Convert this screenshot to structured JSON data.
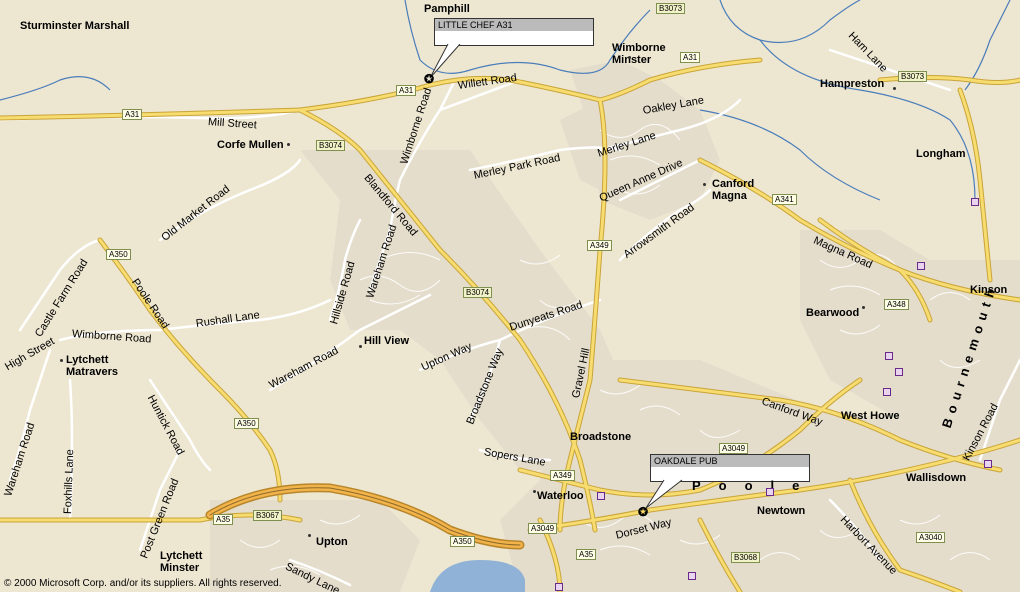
{
  "places": [
    {
      "id": "sturminster-marshall",
      "text": "Sturminster Marshall"
    },
    {
      "id": "pamphill",
      "text": "Pamphill"
    },
    {
      "id": "wimborne-minster",
      "text": "Wimborne\nMinster"
    },
    {
      "id": "hampreston",
      "text": "Hampreston"
    },
    {
      "id": "corfe-mullen",
      "text": "Corfe Mullen"
    },
    {
      "id": "longham",
      "text": "Longham"
    },
    {
      "id": "canford-magna",
      "text": "Canford\nMagna"
    },
    {
      "id": "kinson",
      "text": "Kinson"
    },
    {
      "id": "bearwood",
      "text": "Bearwood"
    },
    {
      "id": "hill-view",
      "text": "Hill View"
    },
    {
      "id": "lytchett-matravers",
      "text": "Lytchett\nMatravers"
    },
    {
      "id": "west-howe",
      "text": "West Howe"
    },
    {
      "id": "broadstone",
      "text": "Broadstone"
    },
    {
      "id": "wallisdown",
      "text": "Wallisdown"
    },
    {
      "id": "waterloo",
      "text": "Waterloo"
    },
    {
      "id": "newtown",
      "text": "Newtown"
    },
    {
      "id": "upton",
      "text": "Upton"
    },
    {
      "id": "lytchett-minster",
      "text": "Lytchett\nMinster"
    }
  ],
  "roads": [
    "Mill Street",
    "Willett Road",
    "Wimborne Road",
    "Blandford Road",
    "Merley Park Road",
    "Oakley Lane",
    "Merley Lane",
    "Queen Anne Drive",
    "Arrowsmith Road",
    "Old Market Road",
    "Castle Farm Road",
    "Poole Road",
    "Wimborne Road",
    "Rushall Lane",
    "Hillside Road",
    "Wareham Road",
    "Wareham Road",
    "Upton Way",
    "Dunyeats Road",
    "Broadstone Way",
    "Gravel Hill",
    "High Street",
    "Huntick Road",
    "Wareham Road",
    "Foxhills Lane",
    "Post Green Road",
    "Sopers Lane",
    "Canford Way",
    "Magna Road",
    "Ham Lane",
    "Kinson Road",
    "Harbort Avenue",
    "Dorset Way",
    "Sandy Lane"
  ],
  "shields": [
    "B3073",
    "A31",
    "A31",
    "A31",
    "B3073",
    "B3074",
    "A341",
    "A349",
    "B3074",
    "A350",
    "A348",
    "A350",
    "A3049",
    "A349",
    "A35",
    "B3067",
    "A3049",
    "A350",
    "A35",
    "B3068",
    "A3040"
  ],
  "callouts": {
    "little_chef": "LITTLE CHEF  A31",
    "oakdale": "OAKDALE PUB"
  },
  "large_labels": {
    "bournemouth": "Bournemouth",
    "poole": "Poole"
  },
  "copyright": "© 2000 Microsoft Corp. and/or its suppliers. All rights reserved.",
  "colors": {
    "background": "#EDE7D2",
    "urban": "#E5DECF",
    "primary_road": "#F5D76E",
    "minor_road": "#FFFFFF",
    "water": "#8FB2D6",
    "river": "#4A7DBA"
  }
}
